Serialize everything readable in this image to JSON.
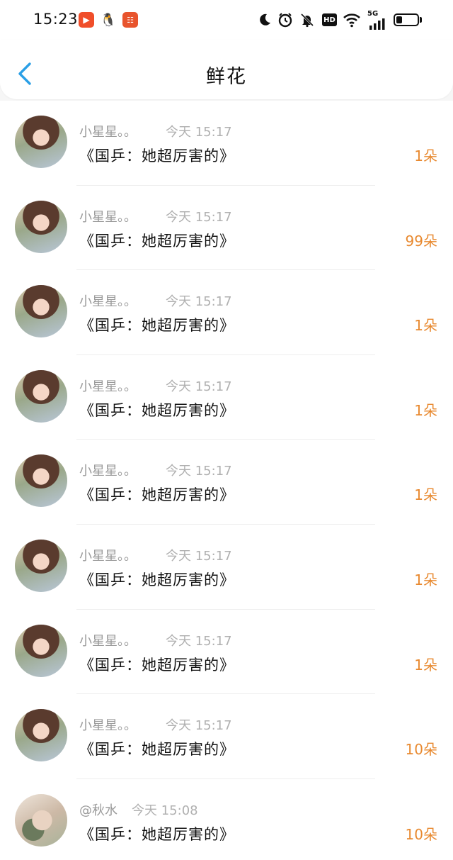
{
  "status_bar": {
    "time": "15:23",
    "hd": "HD",
    "network": "5G",
    "battery_level": 0.3
  },
  "nav": {
    "title": "鲜花"
  },
  "rows": [
    {
      "name": "小星星。。",
      "time": "今天 15:17",
      "message": "《国乒：她超厉害的》",
      "count": "1朵",
      "avatar": "a1"
    },
    {
      "name": "小星星。。",
      "time": "今天 15:17",
      "message": "《国乒：她超厉害的》",
      "count": "99朵",
      "avatar": "a1"
    },
    {
      "name": "小星星。。",
      "time": "今天 15:17",
      "message": "《国乒：她超厉害的》",
      "count": "1朵",
      "avatar": "a1"
    },
    {
      "name": "小星星。。",
      "time": "今天 15:17",
      "message": "《国乒：她超厉害的》",
      "count": "1朵",
      "avatar": "a1"
    },
    {
      "name": "小星星。。",
      "time": "今天 15:17",
      "message": "《国乒：她超厉害的》",
      "count": "1朵",
      "avatar": "a1"
    },
    {
      "name": "小星星。。",
      "time": "今天 15:17",
      "message": "《国乒：她超厉害的》",
      "count": "1朵",
      "avatar": "a1"
    },
    {
      "name": "小星星。。",
      "time": "今天 15:17",
      "message": "《国乒：她超厉害的》",
      "count": "1朵",
      "avatar": "a1"
    },
    {
      "name": "小星星。。",
      "time": "今天 15:17",
      "message": "《国乒：她超厉害的》",
      "count": "10朵",
      "avatar": "a1"
    },
    {
      "name": "@秋水",
      "time": "今天 15:08",
      "message": "《国乒：她超厉害的》",
      "count": "10朵",
      "avatar": "a2"
    }
  ],
  "colors": {
    "accent": "#2a9fe6",
    "count": "#e8892f"
  },
  "icons": {
    "back": "chevron-left-icon",
    "moon": "moon-icon",
    "alarm": "alarm-icon",
    "mute": "bell-off-icon",
    "wifi": "wifi-icon",
    "signal": "signal-icon"
  }
}
